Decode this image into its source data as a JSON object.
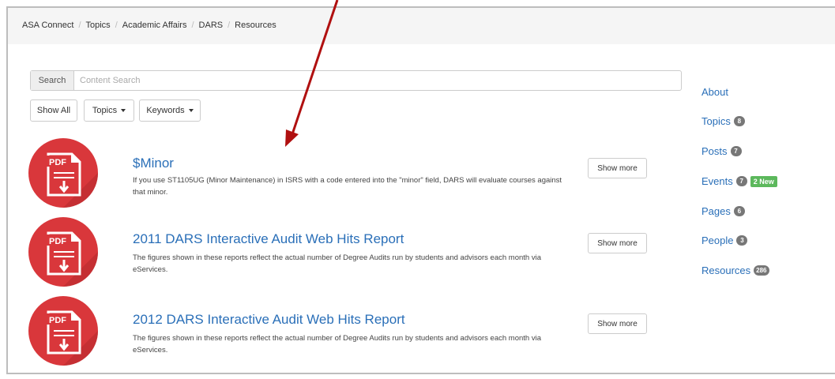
{
  "breadcrumb": [
    "ASA Connect",
    "Topics",
    "Academic Affairs",
    "DARS",
    "Resources"
  ],
  "search": {
    "addon_label": "Search",
    "placeholder": "Content Search",
    "value": ""
  },
  "filters": {
    "show_all": "Show All",
    "topics": "Topics",
    "keywords": "Keywords"
  },
  "results": [
    {
      "icon_label": "PDF",
      "title": "$Minor",
      "description": "If you use ST1105UG (Minor Maintenance) in ISRS with a code entered into the \"minor\" field, DARS will evaluate courses against that minor.",
      "button": "Show more"
    },
    {
      "icon_label": "PDF",
      "title": "2011 DARS Interactive Audit Web Hits Report",
      "description": "The figures shown in these reports reflect the actual number of Degree Audits run by students and advisors each month via eServices.",
      "button": "Show more"
    },
    {
      "icon_label": "PDF",
      "title": "2012 DARS Interactive Audit Web Hits Report",
      "description": "The figures shown in these reports reflect the actual number of Degree Audits run by students and advisors each month via eServices.",
      "button": "Show more"
    }
  ],
  "sidebar": {
    "items": [
      {
        "label": "About",
        "count": ""
      },
      {
        "label": "Topics",
        "count": "8"
      },
      {
        "label": "Posts",
        "count": "7"
      },
      {
        "label": "Events",
        "count": "7",
        "new_badge": "2 New"
      },
      {
        "label": "Pages",
        "count": "6"
      },
      {
        "label": "People",
        "count": "3"
      },
      {
        "label": "Resources",
        "count": "286"
      }
    ]
  },
  "colors": {
    "link": "#2a6fb8",
    "pdf_icon": "#d9373b",
    "annotation_arrow": "#b01010",
    "badge": "#777777",
    "badge_new": "#5cb85c"
  },
  "icons": {
    "file": "pdf-file-icon",
    "annotation": "annotation-arrow"
  }
}
